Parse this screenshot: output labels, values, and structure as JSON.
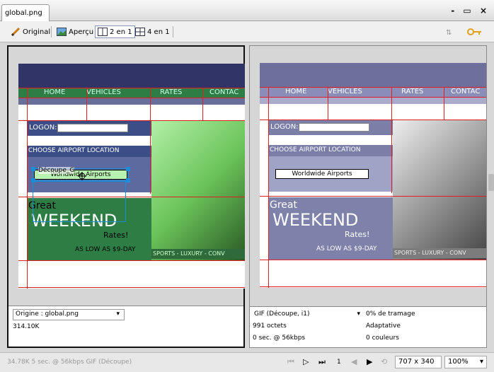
{
  "window": {
    "tab_title": "global.png",
    "controls": "- ▭ ×"
  },
  "toolbar": {
    "original_label": "Original",
    "preview_label": "Aperçu",
    "two_up_label": "2 en 1",
    "four_up_label": "4 en 1"
  },
  "mockup": {
    "nav_items": [
      "HOME",
      "VEHICLES",
      "RATES",
      "CONTAC"
    ],
    "logon_label": "LOGON:",
    "choose_label": "CHOOSE AIRPORT LOCATION",
    "airport_button": "Worldwide Airports",
    "slice_label": "Découpe_G",
    "promo_great": "Great",
    "promo_weekend": "WEEKEND",
    "promo_rates": "Rates!",
    "promo_aslow": "AS LOW AS $9-DAY",
    "sports_label": "SPORTS - LUXURY - CONV"
  },
  "left_info": {
    "origin_label": "Origine : global.png",
    "size": "314.10K"
  },
  "right_info": {
    "format": "GIF (Découpe, i1)",
    "dither": "0% de tramage",
    "bytes": "991 octets",
    "palette": "Adaptative",
    "time": "0 sec. @ 56kbps",
    "colors": "0 couleurs"
  },
  "statusbar": {
    "summary": "34.78K  5 sec. @ 56kbps  GIF (Découpe)",
    "frame_number": "1",
    "dimensions": "707 x 340",
    "zoom": "100%"
  },
  "colors": {
    "nav_green": "#2e7d45",
    "header_navy": "#313466",
    "slice_red": "#e02020",
    "selection_blue": "#1a8cd8"
  }
}
